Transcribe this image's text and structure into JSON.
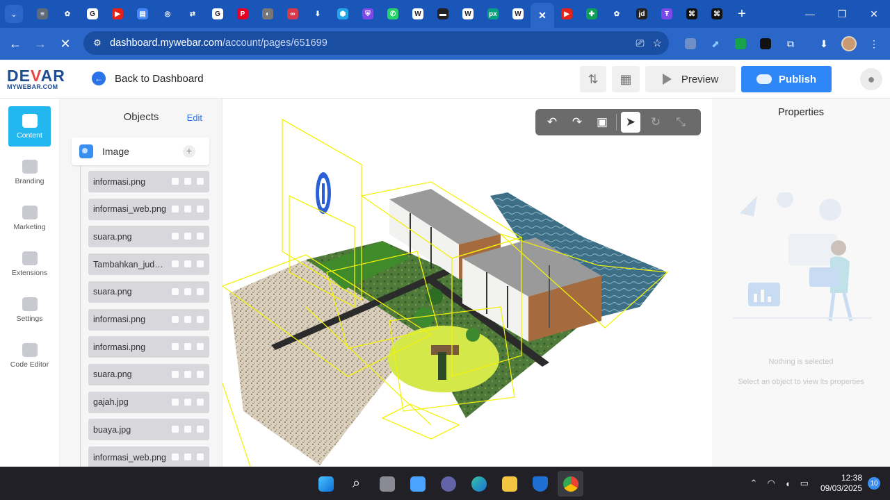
{
  "browser": {
    "tabs": [
      {
        "icon": "stack-icon",
        "color": "#5f6b7a",
        "glyph": "≡"
      },
      {
        "icon": "chatgpt-icon",
        "color": "#1a56b8",
        "glyph": "✿"
      },
      {
        "icon": "google-icon",
        "color": "#ffffff",
        "glyph": "G"
      },
      {
        "icon": "youtube-icon",
        "color": "#e62117",
        "glyph": "▶"
      },
      {
        "icon": "docs-icon",
        "color": "#4285f4",
        "glyph": "▤"
      },
      {
        "icon": "chrome-icon",
        "color": "#1a56b8",
        "glyph": "◎"
      },
      {
        "icon": "arrows-icon",
        "color": "#1a56b8",
        "glyph": "⇄"
      },
      {
        "icon": "google-icon",
        "color": "#ffffff",
        "glyph": "G"
      },
      {
        "icon": "pinterest-icon",
        "color": "#e60023",
        "glyph": "P"
      },
      {
        "icon": "globe-icon",
        "color": "#777777",
        "glyph": "◐"
      },
      {
        "icon": "link-icon",
        "color": "#d63a4a",
        "glyph": "∞"
      },
      {
        "icon": "download-icon",
        "color": "#1a56b8",
        "glyph": "⬇"
      },
      {
        "icon": "cube-icon",
        "color": "#22a6e8",
        "glyph": "⬢"
      },
      {
        "icon": "shield-app-icon",
        "color": "#7b4ae8",
        "glyph": "⛨"
      },
      {
        "icon": "whatsapp-icon",
        "color": "#25d366",
        "glyph": "✆"
      },
      {
        "icon": "wikipedia-icon",
        "color": "#ffffff",
        "glyph": "W"
      },
      {
        "icon": "media-icon",
        "color": "#222222",
        "glyph": "▬"
      },
      {
        "icon": "wikipedia-icon",
        "color": "#ffffff",
        "glyph": "W"
      },
      {
        "icon": "pexels-icon",
        "color": "#05a081",
        "glyph": "px"
      },
      {
        "icon": "wikipedia-icon",
        "color": "#ffffff",
        "glyph": "W"
      },
      {
        "icon": "close-icon",
        "color": "#2a67c8",
        "glyph": "✕",
        "active": true
      },
      {
        "icon": "youtube-icon",
        "color": "#e62117",
        "glyph": "▶"
      },
      {
        "icon": "sheets-icon",
        "color": "#0f9d58",
        "glyph": "✚"
      },
      {
        "icon": "chatgpt-icon",
        "color": "#1a56b8",
        "glyph": "✿"
      },
      {
        "icon": "jd-icon",
        "color": "#222222",
        "glyph": "jd"
      },
      {
        "icon": "app-icon",
        "color": "#7b4ae8",
        "glyph": "Ŧ"
      },
      {
        "icon": "capcut-icon",
        "color": "#111111",
        "glyph": "⌘"
      },
      {
        "icon": "capcut-icon",
        "color": "#111111",
        "glyph": "⌘"
      }
    ],
    "url_host": "dashboard.mywebar.com",
    "url_path": "/account/pages/651699"
  },
  "header": {
    "logo_top_a": "DE",
    "logo_top_v": "V",
    "logo_top_b": "AR",
    "logo_bottom": "MYWEBAR.COM",
    "back_label": "Back to Dashboard",
    "preview_label": "Preview",
    "publish_label": "Publish"
  },
  "sidenav": [
    {
      "name": "content",
      "label": "Content",
      "active": true
    },
    {
      "name": "branding",
      "label": "Branding"
    },
    {
      "name": "marketing",
      "label": "Marketing"
    },
    {
      "name": "extensions",
      "label": "Extensions"
    },
    {
      "name": "settings",
      "label": "Settings"
    },
    {
      "name": "code-editor",
      "label": "Code Editor"
    }
  ],
  "objects": {
    "title": "Objects",
    "edit_label": "Edit",
    "group_label": "Image",
    "items": [
      "informasi.png",
      "informasi_web.png",
      "suara.png",
      "Tambahkan_judul.png",
      "suara.png",
      "informasi.png",
      "informasi.png",
      "suara.png",
      "gajah.jpg",
      "buaya.jpg",
      "informasi_web.png"
    ]
  },
  "properties": {
    "title": "Properties",
    "empty_title": "Nothing is selected",
    "empty_hint": "Select an object to view its properties"
  },
  "taskbar": {
    "time": "12:38",
    "date": "09/03/2025",
    "notifications": "10"
  }
}
